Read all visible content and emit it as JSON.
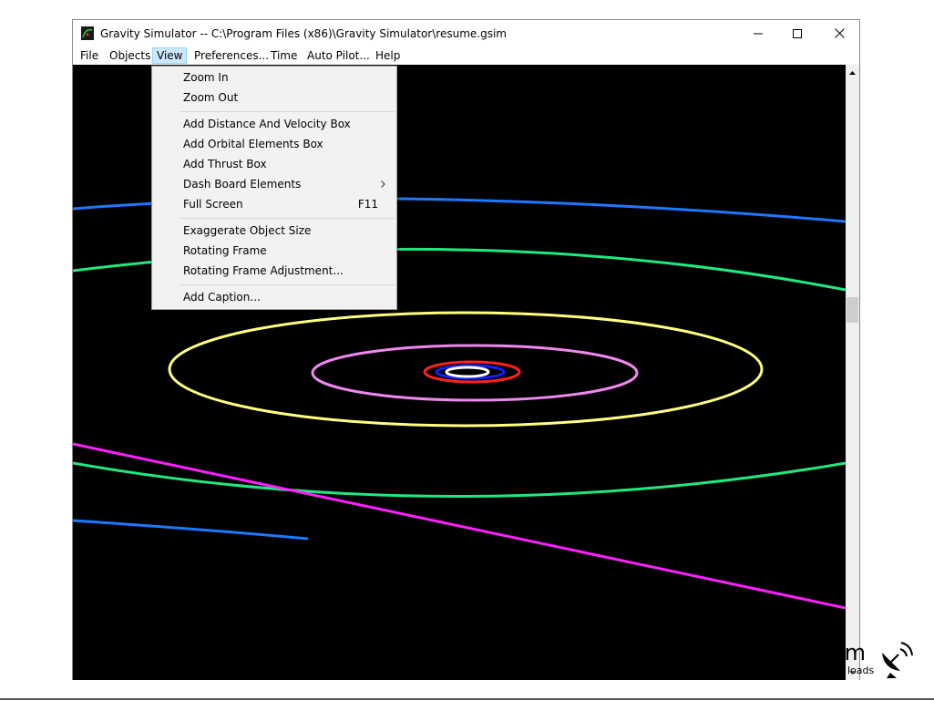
{
  "window": {
    "title": "Gravity Simulator -- C:\\Program Files (x86)\\Gravity Simulator\\resume.gsim"
  },
  "menubar": {
    "items": [
      {
        "label": "File"
      },
      {
        "label": "Objects"
      },
      {
        "label": "View",
        "active": true
      },
      {
        "label": "Preferences..."
      },
      {
        "label": "Time"
      },
      {
        "label": "Auto Pilot..."
      },
      {
        "label": "Help"
      }
    ]
  },
  "view_menu": {
    "items": [
      {
        "label": "Zoom In"
      },
      {
        "label": "Zoom Out"
      },
      {
        "label": "Add Distance And Velocity Box"
      },
      {
        "label": "Add Orbital Elements Box"
      },
      {
        "label": "Add Thrust Box"
      },
      {
        "label": "Dash Board Elements",
        "submenu": true
      },
      {
        "label": "Full Screen",
        "shortcut": "F11"
      },
      {
        "label": "Exaggerate Object Size"
      },
      {
        "label": "Rotating Frame"
      },
      {
        "label": "Rotating Frame Adjustment..."
      },
      {
        "label": "Add Caption..."
      }
    ]
  },
  "orbit_colors": {
    "outer_blue": "#1e78ff",
    "green": "#20e880",
    "yellow": "#ffff80",
    "pink": "#ee88ee",
    "red": "#ff2020",
    "blue": "#1020ff",
    "white": "#ffffff",
    "magenta": "#ff20ff"
  },
  "icons": {
    "minimize": "minimize-icon",
    "maximize": "maximize-icon",
    "close": "close-icon",
    "scroll_up": "scroll-up-arrow-icon",
    "scroll_down": "scroll-down-arrow-icon",
    "submenu": "chevron-right-icon"
  },
  "watermark": {
    "text": "om",
    "subtext": "loads"
  }
}
